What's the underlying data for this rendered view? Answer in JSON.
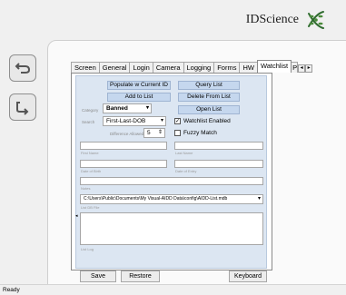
{
  "brand": {
    "name": "IDScience"
  },
  "nav": {
    "back_icon": "undo-arrow-icon",
    "forward_icon": "redo-arrow-icon"
  },
  "tabs": [
    {
      "label": "Screen"
    },
    {
      "label": "General"
    },
    {
      "label": "Login"
    },
    {
      "label": "Camera"
    },
    {
      "label": "Logging"
    },
    {
      "label": "Forms"
    },
    {
      "label": "HW"
    },
    {
      "label": "Watchlist"
    },
    {
      "label": "P"
    }
  ],
  "watchlist": {
    "populate_button": "Populate w Current ID",
    "query_button": "Query List",
    "add_button": "Add to List",
    "delete_button": "Delete From List",
    "open_button": "Open List",
    "category_label": "Category",
    "category_value": "Banned",
    "search_label": "Search",
    "search_value": "First-Last-DOB",
    "difference_label": "Difference Allowed",
    "difference_value": "5",
    "watchlist_enabled_label": "Watchlist Enabled",
    "watchlist_enabled": true,
    "fuzzy_match_label": "Fuzzy Match",
    "fuzzy_match": false,
    "first_name_label": "First Name",
    "last_name_label": "Last Name",
    "dob_label": "Date of Birth",
    "doe_label": "Date of Entry",
    "notes_label": "Notes",
    "file_path": "C:\\Users\\Public\\Documents\\My Visual-AIDD Data\\config\\AIDD-List.mdb",
    "file_label": "List DB File",
    "log_label": "List Log"
  },
  "footer": {
    "save": "Save",
    "restore": "Restore",
    "keyboard": "Keyboard"
  },
  "status": {
    "text": "Ready"
  }
}
